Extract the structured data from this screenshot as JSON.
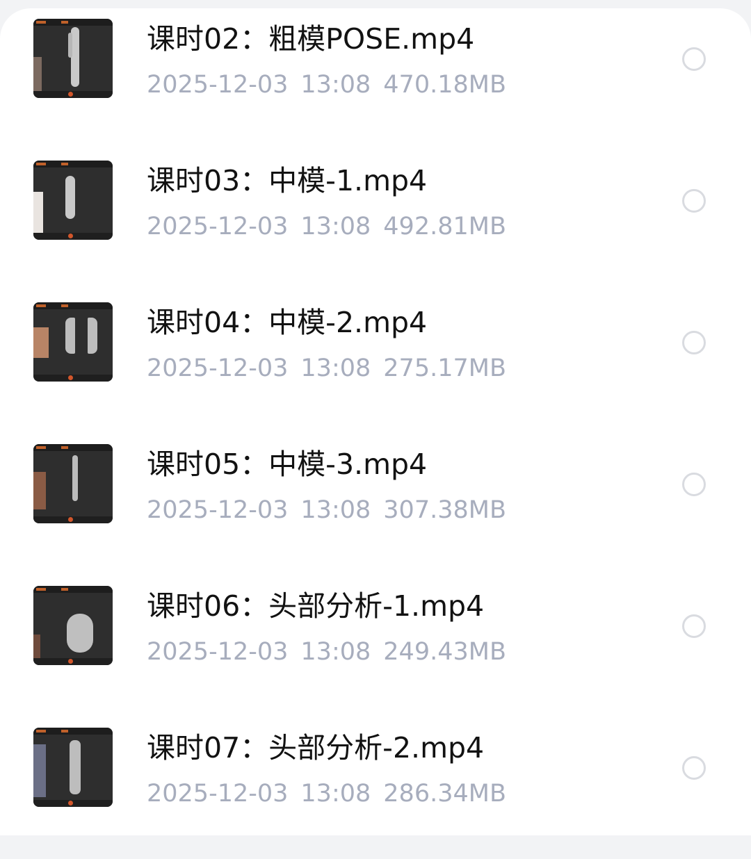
{
  "files": [
    {
      "title": "课时02：粗模POSE.mp4",
      "date": "2025-12-03",
      "time": "13:08",
      "size": "470.18MB",
      "thumbnail_icon": "video-thumbnail-icon",
      "selected": false
    },
    {
      "title": "课时03：中模-1.mp4",
      "date": "2025-12-03",
      "time": "13:08",
      "size": "492.81MB",
      "thumbnail_icon": "video-thumbnail-icon",
      "selected": false
    },
    {
      "title": "课时04：中模-2.mp4",
      "date": "2025-12-03",
      "time": "13:08",
      "size": "275.17MB",
      "thumbnail_icon": "video-thumbnail-icon",
      "selected": false
    },
    {
      "title": "课时05：中模-3.mp4",
      "date": "2025-12-03",
      "time": "13:08",
      "size": "307.38MB",
      "thumbnail_icon": "video-thumbnail-icon",
      "selected": false
    },
    {
      "title": "课时06：头部分析-1.mp4",
      "date": "2025-12-03",
      "time": "13:08",
      "size": "249.43MB",
      "thumbnail_icon": "video-thumbnail-icon",
      "selected": false
    },
    {
      "title": "课时07：头部分析-2.mp4",
      "date": "2025-12-03",
      "time": "13:08",
      "size": "286.34MB",
      "thumbnail_icon": "video-thumbnail-icon",
      "selected": false
    }
  ],
  "colors": {
    "title": "#121212",
    "meta": "#a7adbd",
    "radio_border": "#d9dbe0",
    "background": "#ffffff",
    "page_bg": "#f2f3f5",
    "thumb_bg": "#2e2e2e",
    "thumb_accent": "#d2562b"
  }
}
